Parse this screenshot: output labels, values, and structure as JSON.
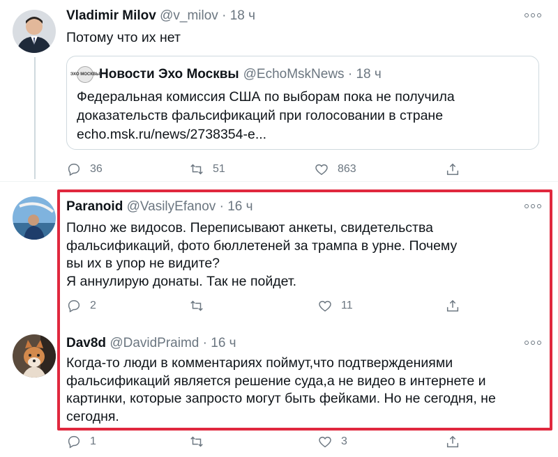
{
  "tweets": [
    {
      "display_name": "Vladimir Milov",
      "handle": "@v_milov",
      "time": "18 ч",
      "text": "Потому что их нет",
      "quote": {
        "logo_text": "ЭХО МОСКВЫ",
        "display_name": "Новости Эхо Москвы",
        "handle": "@EchoMskNews",
        "time": "18 ч",
        "text": "Федеральная комиссия США по выборам пока не получила доказательств фальсификаций при голосовании в стране echo.msk.ru/news/2738354-e..."
      },
      "replies": "36",
      "retweets": "51",
      "likes": "863"
    },
    {
      "display_name": "Paranoid",
      "handle": "@VasilyEfanov",
      "time": "16 ч",
      "text_lines": [
        "Полно же видосов. Переписывают анкеты, свидетельства фальсификаций, фото бюллетеней за трампа в урне. Почему вы их в упор не видите?",
        "Я аннулирую донаты. Так не пойдет."
      ],
      "replies": "2",
      "retweets": "",
      "likes": "11"
    },
    {
      "display_name": "Dav8d",
      "handle": "@DavidPraimd",
      "time": "16 ч",
      "text": "Когда-то люди в комментариях поймут,что подтверждениями фальсификаций является решение суда,а не видео в интернете и картинки, которые запросто могут быть фейками. Но не сегодня, не сегодня.",
      "replies": "1",
      "retweets": "",
      "likes": "3"
    }
  ],
  "colors": {
    "text": "#0f1419",
    "secondary": "#6b7680",
    "border": "#cfd9de",
    "highlight": "#e0283e"
  },
  "icons": [
    "reply-icon",
    "retweet-icon",
    "like-icon",
    "share-icon",
    "more-icon"
  ]
}
